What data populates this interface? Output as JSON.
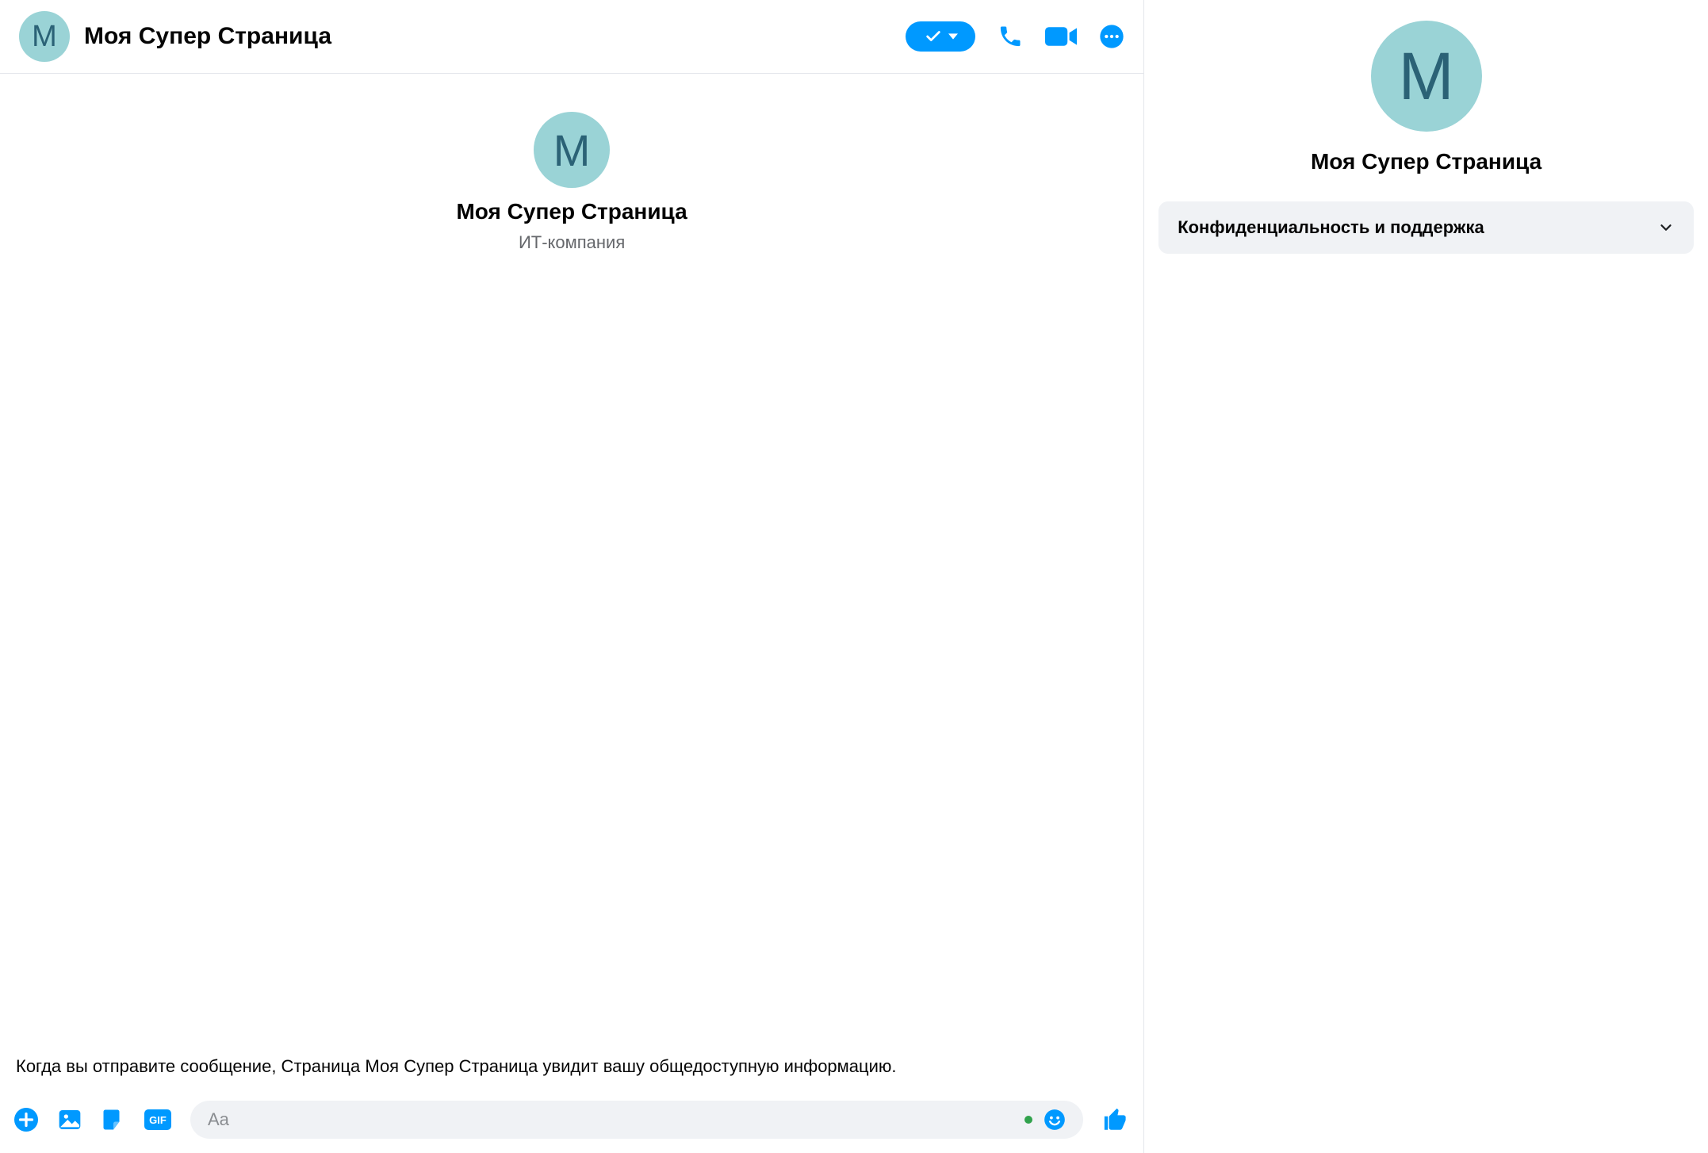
{
  "avatar_letter": "М",
  "header": {
    "title": "Моя Супер Страница"
  },
  "intro": {
    "name": "Моя Супер Страница",
    "subtitle": "ИТ-компания"
  },
  "privacy_notice": "Когда вы отправите сообщение, Страница Моя Супер Страница увидит вашу общедоступную информацию.",
  "composer": {
    "placeholder": "Aa",
    "gif_label": "GIF"
  },
  "info_panel": {
    "name": "Моя Супер Страница",
    "accordion_label": "Конфиденциальность и поддержка"
  },
  "colors": {
    "accent": "#0099ff",
    "avatar_bg": "#9ad3d6",
    "avatar_fg": "#2b6276"
  }
}
